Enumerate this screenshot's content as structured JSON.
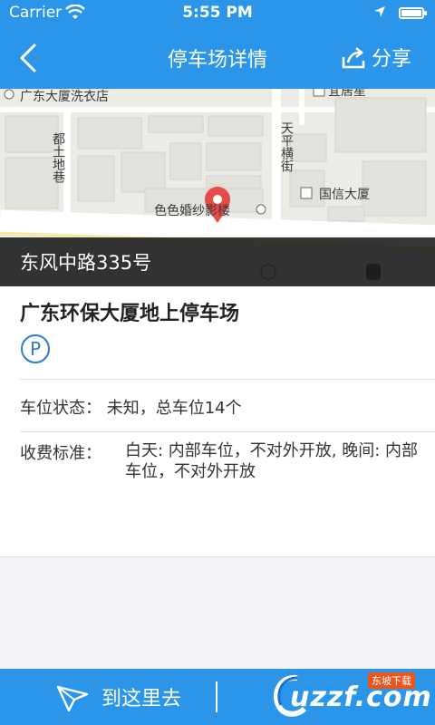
{
  "status_bar": {
    "carrier": "Carrier",
    "time": "5:55 PM"
  },
  "nav": {
    "title": "停车场详情",
    "share_label": "分享"
  },
  "map": {
    "labels": {
      "laundry": "广东大厦洗衣店",
      "top_right": "宜居星",
      "dudi_lane": "都土地巷",
      "tianping_street": "天平横街",
      "guoxin": "国信大厦",
      "wedding": "色色婚纱影楼"
    },
    "address": "东风中路335号"
  },
  "parking": {
    "name": "广东环保大厦地上停车场",
    "type_icon": "P",
    "status_label": "车位状态：",
    "status_value": "未知，总车位14个",
    "fee_label": "收费标准：",
    "fee_value": "白天: 内部车位，不对外开放, 晚间: 内部车位，不对外开放"
  },
  "bottom_bar": {
    "navigate_label": "到这里去"
  },
  "watermark": {
    "text": "uzzf.com",
    "tag": "东坡下载"
  },
  "colors": {
    "primary": "#2b95e9",
    "pin": "#e84a4a",
    "parking_icon": "#2b7cd1"
  }
}
